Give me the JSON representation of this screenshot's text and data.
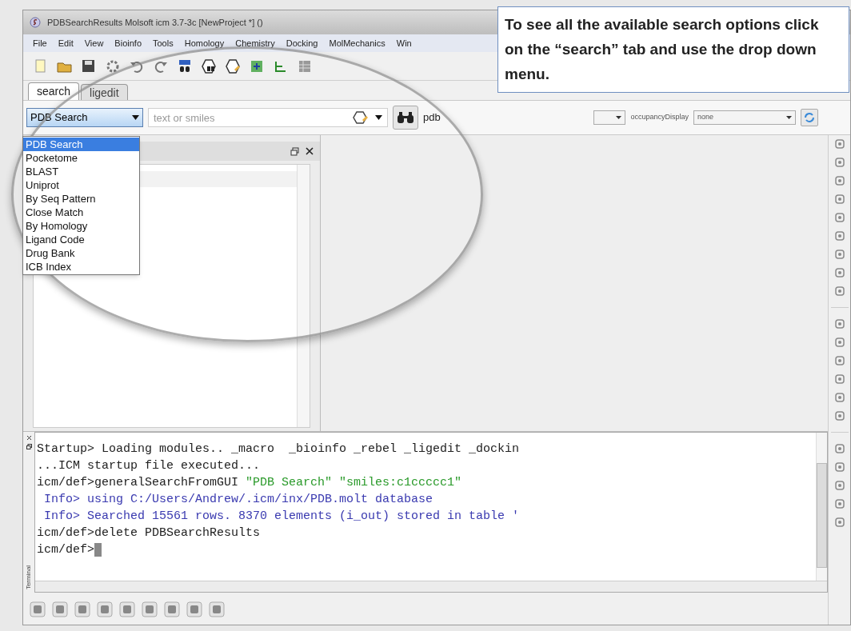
{
  "window": {
    "title": "PDBSearchResults Molsoft icm 3.7-3c  [NewProject *] ()"
  },
  "menu": [
    "File",
    "Edit",
    "View",
    "Bioinfo",
    "Tools",
    "Homology",
    "Chemistry",
    "Docking",
    "MolMechanics",
    "Win"
  ],
  "tabs": [
    {
      "label": "search",
      "selected": true
    },
    {
      "label": "ligedit",
      "selected": false
    }
  ],
  "search_bar": {
    "search_type": "PDB Search",
    "placeholder": "text or smiles",
    "target_label": "pdb"
  },
  "search_type_dropdown": {
    "expanded": true,
    "options": [
      {
        "label": "PDB Search",
        "selected": true
      },
      {
        "label": "Pocketome",
        "selected": false
      },
      {
        "label": "BLAST",
        "selected": false
      },
      {
        "label": "Uniprot",
        "selected": false
      },
      {
        "label": "By Seq Pattern",
        "selected": false
      },
      {
        "label": "Close Match",
        "selected": false
      },
      {
        "label": "By Homology",
        "selected": false
      },
      {
        "label": "Ligand Code",
        "selected": false
      },
      {
        "label": "Drug Bank",
        "selected": false
      },
      {
        "label": "ICB Index",
        "selected": false
      }
    ]
  },
  "display_options": {
    "label": "occupancyDisplay",
    "value": "none"
  },
  "terminal": {
    "label": "Terminal",
    "lines": [
      {
        "kind": "plain",
        "segments": [
          {
            "text": "Startup> Loading modules.. _macro  _bioinfo _rebel _ligedit _dockin",
            "kind": "plain"
          }
        ]
      },
      {
        "kind": "plain",
        "segments": [
          {
            "text": "...ICM startup file executed...",
            "kind": "plain"
          }
        ]
      },
      {
        "kind": "plain",
        "segments": [
          {
            "text": "icm/def>generalSearchFromGUI ",
            "kind": "plain"
          },
          {
            "text": "\"PDB Search\" \"smiles:c1ccccc1\"",
            "kind": "string"
          }
        ]
      },
      {
        "kind": "info",
        "segments": [
          {
            "text": " Info> using C:/Users/Andrew/.icm/inx/PDB.molt database",
            "kind": "plain"
          }
        ]
      },
      {
        "kind": "info",
        "segments": [
          {
            "text": " Info> Searched 15561 rows. 8370 elements (i_out) stored in table '",
            "kind": "plain"
          }
        ]
      },
      {
        "kind": "plain",
        "segments": [
          {
            "text": "icm/def>delete PDBSearchResults",
            "kind": "plain"
          }
        ]
      },
      {
        "kind": "prompt",
        "segments": [
          {
            "text": "icm/def>",
            "kind": "plain"
          }
        ]
      }
    ]
  },
  "callout": {
    "text": "To see all the available search options click on the “search” tab and use the drop down menu."
  }
}
